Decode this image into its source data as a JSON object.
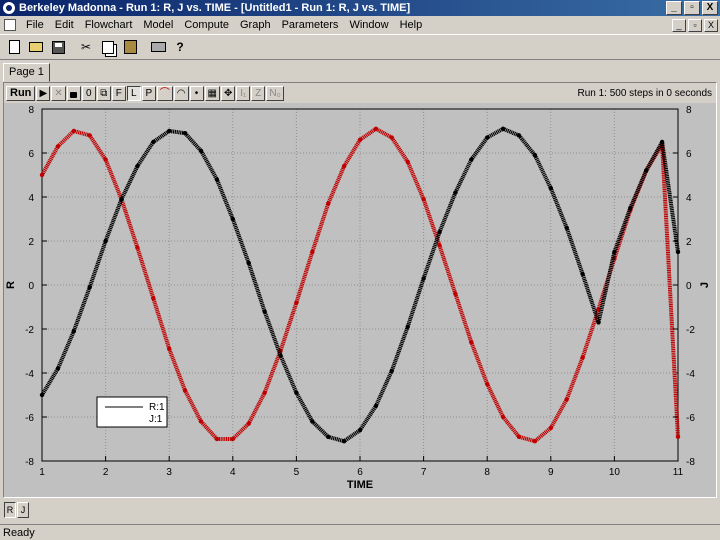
{
  "window": {
    "title": "Berkeley Madonna - Run 1: R, J vs. TIME - [Untitled1 - Run 1: R, J vs. TIME]",
    "min_label": "_",
    "max_label": "▫",
    "close_label": "X"
  },
  "menu": [
    "File",
    "Edit",
    "Flowchart",
    "Model",
    "Compute",
    "Graph",
    "Parameters",
    "Window",
    "Help"
  ],
  "mdi": {
    "min_label": "_",
    "max_label": "▫",
    "close_label": "X"
  },
  "toolbar_icons": [
    "new-icon",
    "open-icon",
    "save-icon",
    "cut-icon",
    "copy-icon",
    "paste-icon",
    "print-icon",
    "help-icon"
  ],
  "tabs": [
    {
      "label": "Page 1"
    }
  ],
  "graph_toolbar": {
    "run_label": "Run",
    "buttons": [
      "▶",
      "✕",
      "🔒",
      "0",
      "⧉",
      "F",
      "L",
      "P",
      "⌒",
      "◠",
      "•",
      "▦",
      "✥",
      "I₁",
      "Z",
      "N₀"
    ],
    "status": "Run 1: 500 steps in 0 seconds"
  },
  "footer_buttons": [
    "R",
    "J"
  ],
  "status_bar": "Ready",
  "chart_data": {
    "type": "line",
    "xlabel": "TIME",
    "ylabel_left": "R",
    "ylabel_right": "J",
    "xlim": [
      1,
      11
    ],
    "ylim": [
      -8,
      8
    ],
    "xticks": [
      1,
      2,
      3,
      4,
      5,
      6,
      7,
      8,
      9,
      10,
      11
    ],
    "xtick_labels": [
      "1",
      "2",
      "3",
      "4",
      "5",
      "6",
      "7",
      "8",
      "9",
      "10",
      "11"
    ],
    "yticks": [
      -8,
      -6,
      -4,
      -2,
      0,
      2,
      4,
      6,
      8
    ],
    "ytick_labels": [
      "-8",
      "-6",
      "-4",
      "-2",
      "0",
      "2",
      "4",
      "6",
      "8"
    ],
    "grid": true,
    "legend_position": "bottom-left",
    "series": [
      {
        "name": "R:1",
        "color": "#c00000",
        "x": [
          1,
          1.25,
          1.5,
          1.75,
          2,
          2.25,
          2.5,
          2.75,
          3,
          3.25,
          3.5,
          3.75,
          4,
          4.25,
          4.5,
          4.75,
          5,
          5.25,
          5.5,
          5.75,
          6,
          6.25,
          6.5,
          6.75,
          7,
          7.25,
          7.5,
          7.75,
          8,
          8.25,
          8.5,
          8.75,
          9,
          9.25,
          9.5,
          9.75,
          10,
          10.25,
          10.5,
          10.75,
          11
        ],
        "y": [
          5.0,
          6.3,
          7.0,
          6.8,
          5.7,
          3.9,
          1.7,
          -0.6,
          -2.9,
          -4.8,
          -6.2,
          -7.0,
          -7.0,
          -6.3,
          -4.9,
          -3.0,
          -0.8,
          1.5,
          3.7,
          5.4,
          6.6,
          7.1,
          6.7,
          5.6,
          3.9,
          1.8,
          -0.4,
          -2.6,
          -4.5,
          -6.0,
          -6.9,
          -7.1,
          -6.5,
          -5.2,
          -3.3,
          -1.1,
          1.2,
          3.4,
          5.2,
          6.4,
          -6.9
        ]
      },
      {
        "name": "J:1",
        "color": "#000000",
        "x": [
          1,
          1.25,
          1.5,
          1.75,
          2,
          2.25,
          2.5,
          2.75,
          3,
          3.25,
          3.5,
          3.75,
          4,
          4.25,
          4.5,
          4.75,
          5,
          5.25,
          5.5,
          5.75,
          6,
          6.25,
          6.5,
          6.75,
          7,
          7.25,
          7.5,
          7.75,
          8,
          8.25,
          8.5,
          8.75,
          9,
          9.25,
          9.5,
          9.75,
          10,
          10.25,
          10.5,
          10.75,
          11
        ],
        "y": [
          -5.0,
          -3.8,
          -2.1,
          -0.1,
          2.0,
          3.9,
          5.4,
          6.5,
          7.0,
          6.9,
          6.1,
          4.8,
          3.0,
          1.0,
          -1.2,
          -3.2,
          -4.9,
          -6.2,
          -6.9,
          -7.1,
          -6.6,
          -5.5,
          -3.9,
          -1.9,
          0.3,
          2.4,
          4.2,
          5.7,
          6.7,
          7.1,
          6.8,
          5.9,
          4.4,
          2.6,
          0.5,
          -1.7,
          1.5,
          3.5,
          5.2,
          6.5,
          1.5
        ]
      }
    ]
  }
}
